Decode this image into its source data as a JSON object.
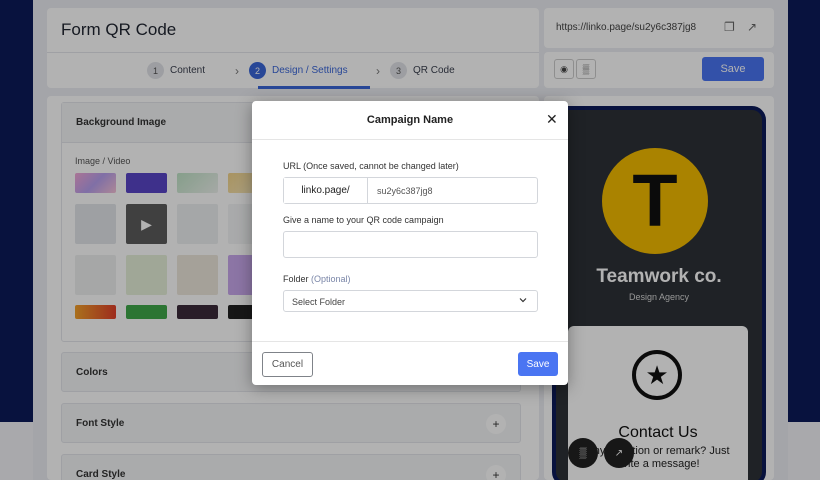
{
  "page": {
    "title": "Form QR Code"
  },
  "stepper": {
    "steps": [
      {
        "num": "1",
        "label": "Content"
      },
      {
        "num": "2",
        "label": "Design / Settings"
      },
      {
        "num": "3",
        "label": "QR Code"
      }
    ],
    "active_step": "2"
  },
  "url_bar": {
    "url": "https://linko.page/su2y6c387jg8",
    "copy_icon": "copy-icon",
    "open_icon": "external-link-icon"
  },
  "toolbar": {
    "preview_icon": "eye-icon",
    "qr_icon": "qr-icon",
    "save_label": "Save"
  },
  "panels": {
    "background": {
      "title": "Background Image",
      "media_label": "Image / Video"
    },
    "colors": {
      "title": "Colors"
    },
    "font": {
      "title": "Font Style",
      "toggle": "+"
    },
    "card": {
      "title": "Card Style",
      "toggle": "+"
    }
  },
  "preview": {
    "logo_letter": "T",
    "company": "Teamwork co.",
    "subtitle": "Design Agency",
    "contact_title": "Contact Us",
    "contact_text": "Any question or remark? Just write a message!",
    "star_icon": "star-icon"
  },
  "modal": {
    "title": "Campaign Name",
    "close_icon": "close-icon",
    "url_label": "URL (Once saved, cannot be changed later)",
    "url_prefix": "linko.page/",
    "url_slug": "su2y6c387jg8",
    "name_label": "Give a name to your QR code campaign",
    "name_value": "",
    "folder_label": "Folder",
    "folder_optional": "(Optional)",
    "folder_selected": "Select Folder",
    "cancel_label": "Cancel",
    "save_label": "Save"
  },
  "colors": {
    "accent": "#4a75f2",
    "navy": "#0c1a5a",
    "logo_yellow": "#f4bc00"
  }
}
